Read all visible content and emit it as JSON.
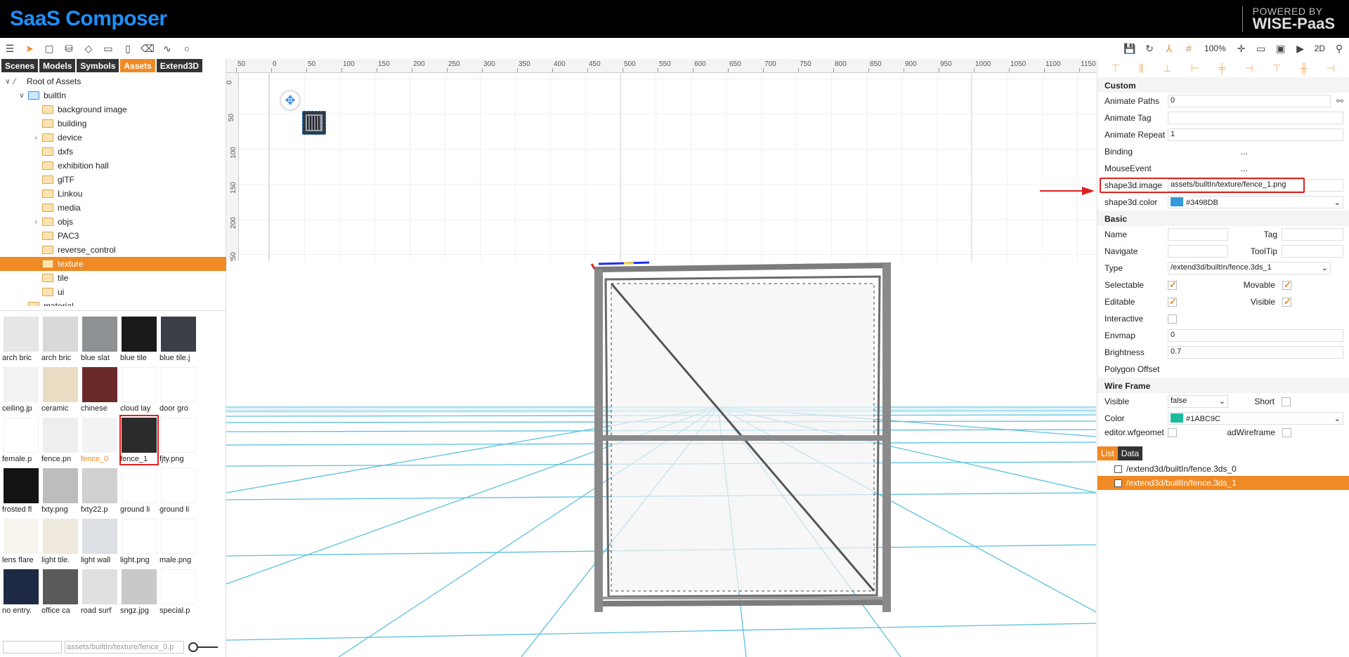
{
  "app": {
    "title": "SaaS Composer",
    "powered_line1": "POWERED BY",
    "powered_line2": "WISE-PaaS"
  },
  "toolbar": {
    "zoom": "100%",
    "mode": "2D"
  },
  "left_tabs": [
    {
      "label": "Scenes",
      "active": false
    },
    {
      "label": "Models",
      "active": false
    },
    {
      "label": "Symbols",
      "active": false
    },
    {
      "label": "Assets",
      "active": true
    },
    {
      "label": "Extend3D",
      "active": false
    }
  ],
  "tree": {
    "root": "Root of Assets",
    "builtin": "builtIn",
    "folders": [
      {
        "label": "background image",
        "expandable": false,
        "selected": false
      },
      {
        "label": "building",
        "expandable": false,
        "selected": false
      },
      {
        "label": "device",
        "expandable": true,
        "selected": false
      },
      {
        "label": "dxfs",
        "expandable": false,
        "selected": false
      },
      {
        "label": "exhibition hall",
        "expandable": false,
        "selected": false
      },
      {
        "label": "glTF",
        "expandable": false,
        "selected": false
      },
      {
        "label": "Linkou",
        "expandable": false,
        "selected": false
      },
      {
        "label": "media",
        "expandable": false,
        "selected": false
      },
      {
        "label": "objs",
        "expandable": true,
        "selected": false
      },
      {
        "label": "PAC3",
        "expandable": false,
        "selected": false
      },
      {
        "label": "reverse_control",
        "expandable": false,
        "selected": false
      },
      {
        "label": "texture",
        "expandable": false,
        "selected": true
      },
      {
        "label": "tile",
        "expandable": false,
        "selected": false
      },
      {
        "label": "ui",
        "expandable": false,
        "selected": false
      }
    ],
    "material": "material"
  },
  "thumbnails": [
    {
      "label": "arch bric",
      "color": "#e6e6e6"
    },
    {
      "label": "arch bric",
      "color": "#d9d9d9"
    },
    {
      "label": "blue slat",
      "color": "#8d9194"
    },
    {
      "label": "blue tile",
      "color": "#1a1a1a"
    },
    {
      "label": "blue tile.j",
      "color": "#3c4046"
    },
    {
      "label": "ceiling.jp",
      "color": "#f2f2f2"
    },
    {
      "label": "ceramic",
      "color": "#eadcc3"
    },
    {
      "label": "chinese",
      "color": "#6b2a2a"
    },
    {
      "label": "cloud lay",
      "color": "#ffffff"
    },
    {
      "label": "door gro",
      "color": "#ffffff"
    },
    {
      "label": "female.p",
      "color": "#ffffff"
    },
    {
      "label": "fence.pn",
      "color": "#eeeeee"
    },
    {
      "label": "fence_0",
      "color": "#f3f3f3"
    },
    {
      "label": "fence_1",
      "color": "#2b2b2b"
    },
    {
      "label": "fjty.png",
      "color": "#ffffff"
    },
    {
      "label": "frosted fl",
      "color": "#141414"
    },
    {
      "label": "fxty.png",
      "color": "#bdbdbd"
    },
    {
      "label": "fxty22.p",
      "color": "#d0d0d0"
    },
    {
      "label": "ground li",
      "color": "#ffffff"
    },
    {
      "label": "ground li",
      "color": "#ffffff"
    },
    {
      "label": "lens flare",
      "color": "#f7f4ee"
    },
    {
      "label": "light tile.",
      "color": "#efe9de"
    },
    {
      "label": "light wall",
      "color": "#dcdfe3"
    },
    {
      "label": "light.png",
      "color": "#ffffff"
    },
    {
      "label": "male.png",
      "color": "#ffffff"
    },
    {
      "label": "no entry.",
      "color": "#1e2a44"
    },
    {
      "label": "office ca",
      "color": "#5a5a5a"
    },
    {
      "label": "road surf",
      "color": "#e0e0e0"
    },
    {
      "label": "sngz.jpg",
      "color": "#c9c9c9"
    },
    {
      "label": "special.p",
      "color": "#ffffff"
    }
  ],
  "left_footer": {
    "search_value": "",
    "path_value": "assets/builtIn/texture/fence_0.p"
  },
  "ruler_h": [
    "50",
    "0",
    "50",
    "100",
    "150",
    "200",
    "250",
    "300",
    "350",
    "400",
    "450",
    "500",
    "550",
    "600",
    "650",
    "700",
    "750",
    "800",
    "850",
    "900",
    "950",
    "1000",
    "1050",
    "1100",
    "1150"
  ],
  "ruler_v": [
    "0",
    "50",
    "100",
    "150",
    "200",
    "250"
  ],
  "sections": {
    "custom": "Custom",
    "basic": "Basic",
    "wireframe": "Wire Frame"
  },
  "props": {
    "animate_paths": {
      "key": "Animate Paths",
      "value": "0"
    },
    "animate_tag": {
      "key": "Animate Tag",
      "value": ""
    },
    "animate_repeat": {
      "key": "Animate Repeat",
      "value": "1"
    },
    "binding": {
      "key": "Binding",
      "value": "..."
    },
    "mouse_event": {
      "key": "MouseEvent",
      "value": "..."
    },
    "shape3d_image": {
      "key": "shape3d.image",
      "value": "assets/builtIn/texture/fence_1.png"
    },
    "shape3d_color": {
      "key": "shape3d.color",
      "value": "#3498DB",
      "swatch": "#3498DB"
    },
    "name": {
      "key": "Name",
      "value": ""
    },
    "tag": {
      "key": "Tag",
      "value": ""
    },
    "navigate": {
      "key": "Navigate",
      "value": ""
    },
    "tooltip": {
      "key": "ToolTip",
      "value": ""
    },
    "type": {
      "key": "Type",
      "value": "/extend3d/builtIn/fence.3ds_1"
    },
    "selectable": {
      "key": "Selectable",
      "checked": true
    },
    "movable": {
      "key": "Movable",
      "checked": true
    },
    "editable": {
      "key": "Editable",
      "checked": true
    },
    "visible_basic": {
      "key": "Visible",
      "checked": true
    },
    "interactive": {
      "key": "Interactive",
      "checked": false
    },
    "envmap": {
      "key": "Envmap",
      "value": "0"
    },
    "brightness": {
      "key": "Brightness",
      "value": "0.7"
    },
    "polygon_offset": {
      "key": "Polygon Offset"
    },
    "wf_visible": {
      "key": "Visible",
      "value": "false"
    },
    "wf_short": {
      "key": "Short",
      "checked": false
    },
    "wf_color": {
      "key": "Color",
      "value": "#1ABC9C",
      "swatch": "#1ABC9C"
    },
    "wf_geom": {
      "key": "editor.wfgeomet",
      "checked": false
    },
    "wf_loaded": {
      "key": "adWireframe",
      "checked": false
    }
  },
  "bottom_tabs": [
    {
      "label": "List",
      "active": true
    },
    {
      "label": "Data",
      "active": false
    }
  ],
  "list_items": [
    {
      "label": "/extend3d/builtIn/fence.3ds_0",
      "selected": false
    },
    {
      "label": "/extend3d/builtIn/fence.3ds_1",
      "selected": true
    }
  ],
  "colors": {
    "accent": "#f08a24",
    "brand": "#1e90ff",
    "grid3d": "#5bc0de",
    "highlight": "#e02020"
  }
}
